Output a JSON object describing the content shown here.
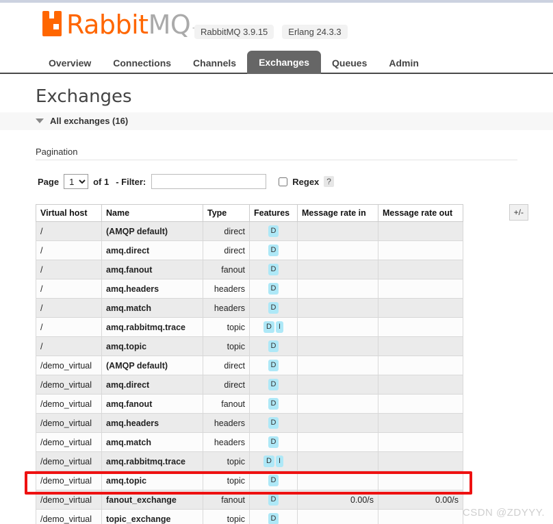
{
  "header": {
    "logo_text_part1": "Rabbit",
    "logo_text_part2": "MQ",
    "trademark": "TM",
    "versions": [
      {
        "label": "RabbitMQ 3.9.15"
      },
      {
        "label": "Erlang 24.3.3"
      }
    ]
  },
  "nav": {
    "tabs": [
      {
        "label": "Overview",
        "active": false
      },
      {
        "label": "Connections",
        "active": false
      },
      {
        "label": "Channels",
        "active": false
      },
      {
        "label": "Exchanges",
        "active": true
      },
      {
        "label": "Queues",
        "active": false
      },
      {
        "label": "Admin",
        "active": false
      }
    ]
  },
  "page": {
    "title": "Exchanges",
    "section_title": "All exchanges (16)",
    "pagination_label": "Pagination"
  },
  "filter": {
    "page_label": "Page",
    "page_value": "1",
    "page_options": [
      "1"
    ],
    "of_label": "of 1",
    "filter_label": "- Filter:",
    "filter_value": "",
    "filter_placeholder": "",
    "regex_label": "Regex",
    "regex_checked": false,
    "help_label": "?"
  },
  "table": {
    "columns": [
      "Virtual host",
      "Name",
      "Type",
      "Features",
      "Message rate in",
      "Message rate out"
    ],
    "plusminus_label": "+/-",
    "rows": [
      {
        "vhost": "/",
        "name": "(AMQP default)",
        "type": "direct",
        "features": [
          "D"
        ],
        "rate_in": "",
        "rate_out": ""
      },
      {
        "vhost": "/",
        "name": "amq.direct",
        "type": "direct",
        "features": [
          "D"
        ],
        "rate_in": "",
        "rate_out": ""
      },
      {
        "vhost": "/",
        "name": "amq.fanout",
        "type": "fanout",
        "features": [
          "D"
        ],
        "rate_in": "",
        "rate_out": ""
      },
      {
        "vhost": "/",
        "name": "amq.headers",
        "type": "headers",
        "features": [
          "D"
        ],
        "rate_in": "",
        "rate_out": ""
      },
      {
        "vhost": "/",
        "name": "amq.match",
        "type": "headers",
        "features": [
          "D"
        ],
        "rate_in": "",
        "rate_out": ""
      },
      {
        "vhost": "/",
        "name": "amq.rabbitmq.trace",
        "type": "topic",
        "features": [
          "D",
          "I"
        ],
        "rate_in": "",
        "rate_out": ""
      },
      {
        "vhost": "/",
        "name": "amq.topic",
        "type": "topic",
        "features": [
          "D"
        ],
        "rate_in": "",
        "rate_out": ""
      },
      {
        "vhost": "/demo_virtual",
        "name": "(AMQP default)",
        "type": "direct",
        "features": [
          "D"
        ],
        "rate_in": "",
        "rate_out": ""
      },
      {
        "vhost": "/demo_virtual",
        "name": "amq.direct",
        "type": "direct",
        "features": [
          "D"
        ],
        "rate_in": "",
        "rate_out": ""
      },
      {
        "vhost": "/demo_virtual",
        "name": "amq.fanout",
        "type": "fanout",
        "features": [
          "D"
        ],
        "rate_in": "",
        "rate_out": ""
      },
      {
        "vhost": "/demo_virtual",
        "name": "amq.headers",
        "type": "headers",
        "features": [
          "D"
        ],
        "rate_in": "",
        "rate_out": ""
      },
      {
        "vhost": "/demo_virtual",
        "name": "amq.match",
        "type": "headers",
        "features": [
          "D"
        ],
        "rate_in": "",
        "rate_out": ""
      },
      {
        "vhost": "/demo_virtual",
        "name": "amq.rabbitmq.trace",
        "type": "topic",
        "features": [
          "D",
          "I"
        ],
        "rate_in": "",
        "rate_out": ""
      },
      {
        "vhost": "/demo_virtual",
        "name": "amq.topic",
        "type": "topic",
        "features": [
          "D"
        ],
        "rate_in": "",
        "rate_out": ""
      },
      {
        "vhost": "/demo_virtual",
        "name": "fanout_exchange",
        "type": "fanout",
        "features": [
          "D"
        ],
        "rate_in": "0.00/s",
        "rate_out": "0.00/s"
      },
      {
        "vhost": "/demo_virtual",
        "name": "topic_exchange",
        "type": "topic",
        "features": [
          "D"
        ],
        "rate_in": "",
        "rate_out": ""
      }
    ]
  },
  "annotation": {
    "highlight_color": "#ee1111",
    "highlighted_row_name": "fanout_exchange"
  },
  "watermark": {
    "text": "CSDN @ZDYYY."
  },
  "colors": {
    "brand_orange": "#ff6600",
    "active_tab_bg": "#666666",
    "badge_bg": "#aee8f7",
    "top_strip": "#ccd2e0"
  }
}
